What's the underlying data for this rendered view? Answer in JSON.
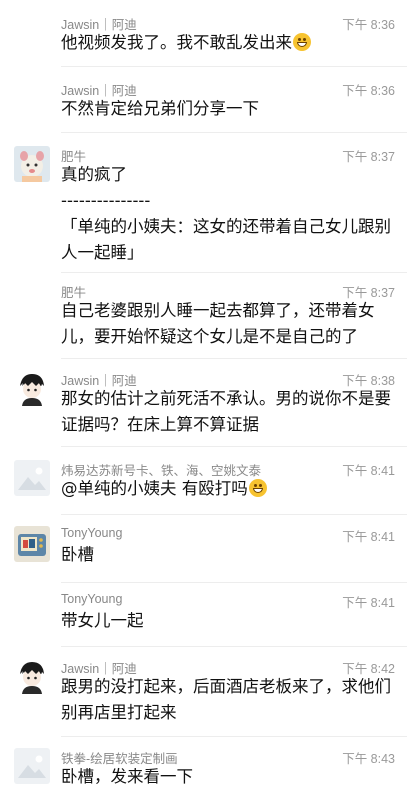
{
  "messages": [
    {
      "name": "Jawsin｜阿迪",
      "time": "下午 8:36",
      "avatar": "none",
      "text": "他视频发我了。我不敢乱发出来",
      "emoji": "grin-emoji"
    },
    {
      "name": "Jawsin｜阿迪",
      "time": "下午 8:36",
      "avatar": "none",
      "text": "不然肯定给兄弟们分享一下"
    },
    {
      "name": "肥牛",
      "time": "下午 8:37",
      "avatar": "cartoon-animal-avatar",
      "lines": [
        "真的疯了",
        "---------------",
        "「单纯的小姨夫：这女的还带着自己女儿跟别人一起睡」"
      ]
    },
    {
      "name": "肥牛",
      "time": "下午 8:37",
      "avatar": "none",
      "text": "自己老婆跟别人睡一起去都算了，还带着女儿，要开始怀疑这个女儿是不是自己的了"
    },
    {
      "name": "Jawsin｜阿迪",
      "time": "下午 8:38",
      "avatar": "anime-boy-avatar",
      "text": "那女的估计之前死活不承认。男的说你不是要证据吗？在床上算不算证据"
    },
    {
      "name": "炜易达苏新号卡、铁、海、空姚文泰",
      "time": "下午 8:41",
      "avatar": "placeholder-image-avatar",
      "text": "@单纯的小姨夫 有殴打吗",
      "emoji": "laugh-emoji"
    },
    {
      "name": "TonyYoung",
      "time": "下午 8:41",
      "avatar": "retro-tv-avatar",
      "text": "卧槽"
    },
    {
      "name": "TonyYoung",
      "time": "下午 8:41",
      "avatar": "none",
      "text": "带女儿一起"
    },
    {
      "name": "Jawsin｜阿迪",
      "time": "下午 8:42",
      "avatar": "anime-boy-avatar",
      "text": "跟男的没打起来，后面酒店老板来了，求他们别再店里打起来"
    },
    {
      "name": "铁拳-绘居软装定制画",
      "time": "下午 8:43",
      "avatar": "placeholder-image-avatar",
      "text": "卧槽，发来看一下"
    }
  ]
}
